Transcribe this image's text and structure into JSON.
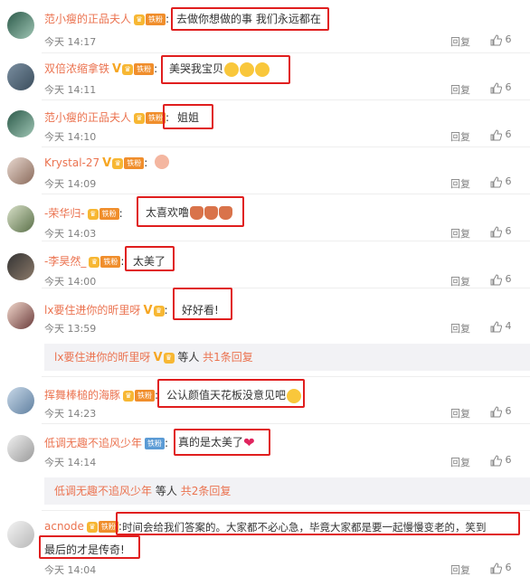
{
  "comments": [
    {
      "name": "范小瘦的正品夫人",
      "badge": "铁粉",
      "text": "去做你想做的事 我们永远都在",
      "time": "今天 14:17",
      "reply": "回复",
      "likes": "6"
    },
    {
      "name": "双倍浓缩拿铁",
      "badge": "铁粉",
      "text": "美哭我宝贝",
      "time": "今天 14:11",
      "reply": "回复",
      "likes": "6"
    },
    {
      "name": "范小瘦的正品夫人",
      "badge": "铁粉",
      "text": "姐姐",
      "time": "今天 14:10",
      "reply": "回复",
      "likes": "6"
    },
    {
      "name": "Krystal-27",
      "badge": "铁粉",
      "text": "",
      "time": "今天 14:09",
      "reply": "回复",
      "likes": "6"
    },
    {
      "name": "-荣华归-",
      "badge": "铁粉",
      "text": "太喜欢噜",
      "time": "今天 14:03",
      "reply": "回复",
      "likes": "6"
    },
    {
      "name": "-李昊然_",
      "badge": "铁粉",
      "text": "太美了",
      "time": "今天 14:00",
      "reply": "回复",
      "likes": "6"
    },
    {
      "name": "lx要住进你的昕里呀",
      "badge": "",
      "text": "好好看!",
      "time": "今天 13:59",
      "reply": "回复",
      "likes": "4"
    },
    {
      "name": "挥舞棒槌的海豚",
      "badge": "铁粉",
      "text": "公认颜值天花板没意见吧",
      "time": "今天 14:23",
      "reply": "回复",
      "likes": "6"
    },
    {
      "name": "低调无趣不追风少年",
      "badge": "铁粉",
      "text": "真的是太美了",
      "time": "今天 14:14",
      "reply": "回复",
      "likes": "6"
    },
    {
      "name": "acnode",
      "badge": "铁粉",
      "text": "时间会给我们答案的。大家都不必心急，毕竟大家都是要一起慢慢变老的，笑到",
      "text2": "最后的才是传奇!",
      "time": "今天 14:04",
      "reply": "回复",
      "likes": "6"
    }
  ],
  "sub1": {
    "name": "lx要住进你的昕里呀",
    "mid": "等人",
    "count": "共1条回复"
  },
  "sub2": {
    "name": "低调无趣不追风少年",
    "mid": "等人",
    "count": "共2条回复"
  },
  "colors": {
    "name": "#eb7350",
    "highlight": "#e01e1e",
    "meta": "#808080"
  }
}
